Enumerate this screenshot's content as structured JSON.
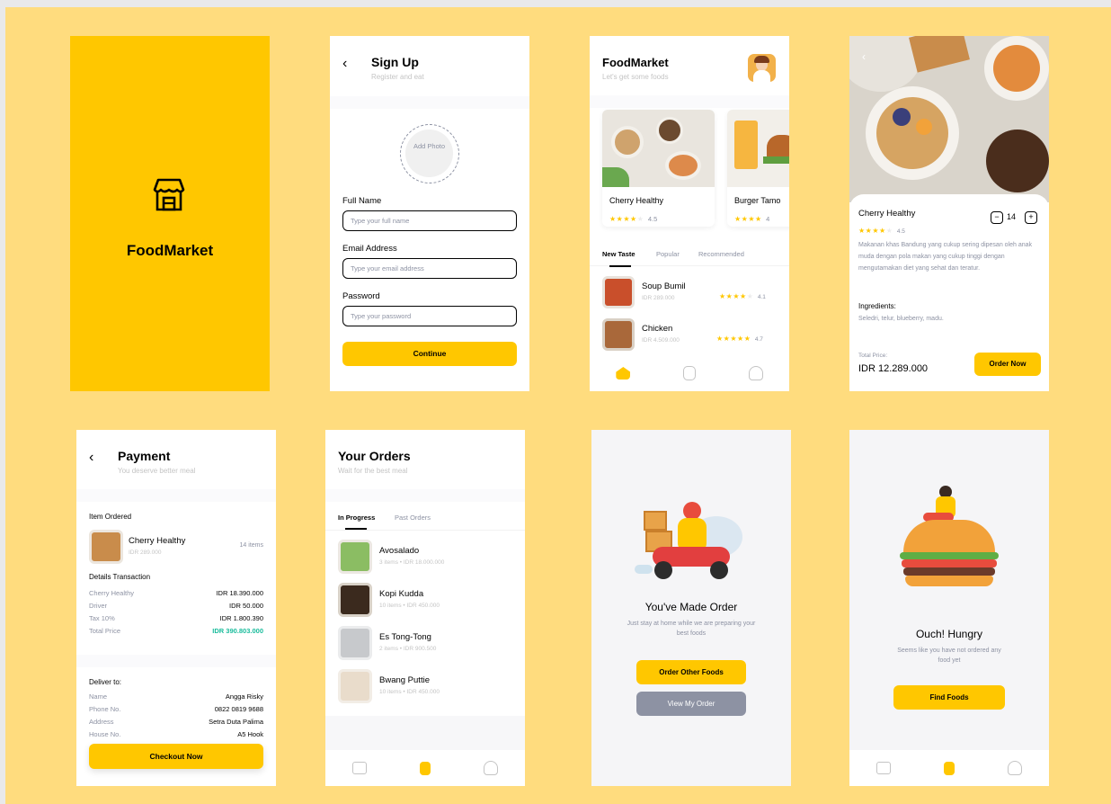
{
  "splash": {
    "brand": "FoodMarket"
  },
  "signup": {
    "title": "Sign Up",
    "subtitle": "Register and eat",
    "add_photo": "Add Photo",
    "fields": [
      {
        "label": "Full Name",
        "placeholder": "Type your full name"
      },
      {
        "label": "Email Address",
        "placeholder": "Type your email address"
      },
      {
        "label": "Password",
        "placeholder": "Type your password"
      }
    ],
    "continue_label": "Continue"
  },
  "home": {
    "title": "FoodMarket",
    "subtitle": "Let's get some foods",
    "cards": [
      {
        "name": "Cherry Healthy",
        "rating": "4.5",
        "stars": 4
      },
      {
        "name": "Burger Tamo",
        "rating": "4",
        "stars": 4
      }
    ],
    "tabs": [
      "New Taste",
      "Popular",
      "Recommended"
    ],
    "items": [
      {
        "name": "Soup Bumil",
        "price": "IDR 289.000",
        "rating": "4.1",
        "stars": 4
      },
      {
        "name": "Chicken",
        "price": "IDR 4.509.000",
        "rating": "4.7",
        "stars": 5
      }
    ]
  },
  "detail": {
    "name": "Cherry Healthy",
    "rating": "4.5",
    "stars": 4,
    "quantity": "14",
    "minus": "−",
    "plus": "+",
    "description": "Makanan khas Bandung yang cukup sering dipesan oleh anak muda dengan pola makan yang cukup tinggi dengan mengutamakan diet yang sehat dan teratur.",
    "ingredients_label": "Ingredients:",
    "ingredients": "Seledri, telur, blueberry, madu.",
    "total_label": "Total Price:",
    "total_value": "IDR 12.289.000",
    "order_label": "Order Now"
  },
  "payment": {
    "title": "Payment",
    "subtitle": "You deserve better meal",
    "item_ordered_label": "Item Ordered",
    "item": {
      "name": "Cherry Healthy",
      "price": "IDR 289.000",
      "qty": "14 items"
    },
    "details_label": "Details Transaction",
    "details": [
      {
        "k": "Cherry Healthy",
        "v": "IDR 18.390.000"
      },
      {
        "k": "Driver",
        "v": "IDR 50.000"
      },
      {
        "k": "Tax 10%",
        "v": "IDR 1.800.390"
      },
      {
        "k": "Total Price",
        "v": "IDR 390.803.000"
      }
    ],
    "deliver_label": "Deliver to:",
    "deliver": [
      {
        "k": "Name",
        "v": "Angga Risky"
      },
      {
        "k": "Phone No.",
        "v": "0822 0819 9688"
      },
      {
        "k": "Address",
        "v": "Setra Duta Palima"
      },
      {
        "k": "House No.",
        "v": "A5 Hook"
      }
    ],
    "checkout_label": "Checkout Now",
    "accent_total": "#1abc9c"
  },
  "orders": {
    "title": "Your Orders",
    "subtitle": "Wait for the best meal",
    "tabs": [
      "In Progress",
      "Past Orders"
    ],
    "items": [
      {
        "name": "Avosalado",
        "meta": "3 items • IDR 18.000.000"
      },
      {
        "name": "Kopi Kudda",
        "meta": "10 items • IDR 450.000"
      },
      {
        "name": "Es Tong-Tong",
        "meta": "2 items • IDR 900.500"
      },
      {
        "name": "Bwang Puttie",
        "meta": "10 items • IDR 450.000"
      }
    ]
  },
  "success": {
    "title": "You've Made Order",
    "message": "Just stay at home while we are preparing your best foods",
    "primary_label": "Order Other Foods",
    "secondary_label": "View My Order"
  },
  "empty": {
    "title": "Ouch! Hungry",
    "message": "Seems like you have not ordered any food yet",
    "button_label": "Find Foods"
  },
  "colors": {
    "accent": "#ffc700",
    "background": "#ffdc7e",
    "muted": "#8d92a3",
    "dark": "#020202"
  }
}
